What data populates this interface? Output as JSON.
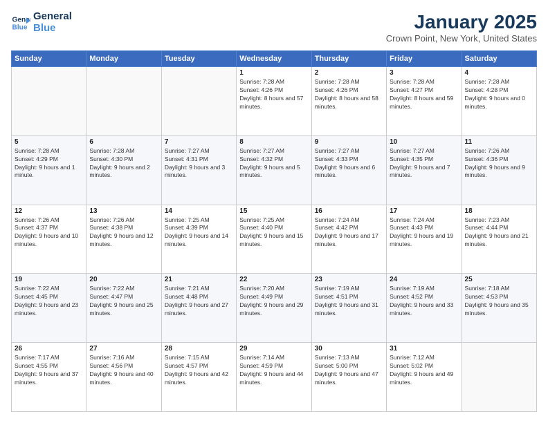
{
  "logo": {
    "line1": "General",
    "line2": "Blue"
  },
  "title": "January 2025",
  "subtitle": "Crown Point, New York, United States",
  "weekdays": [
    "Sunday",
    "Monday",
    "Tuesday",
    "Wednesday",
    "Thursday",
    "Friday",
    "Saturday"
  ],
  "weeks": [
    [
      {
        "day": "",
        "text": ""
      },
      {
        "day": "",
        "text": ""
      },
      {
        "day": "",
        "text": ""
      },
      {
        "day": "1",
        "text": "Sunrise: 7:28 AM\nSunset: 4:26 PM\nDaylight: 8 hours and 57 minutes."
      },
      {
        "day": "2",
        "text": "Sunrise: 7:28 AM\nSunset: 4:26 PM\nDaylight: 8 hours and 58 minutes."
      },
      {
        "day": "3",
        "text": "Sunrise: 7:28 AM\nSunset: 4:27 PM\nDaylight: 8 hours and 59 minutes."
      },
      {
        "day": "4",
        "text": "Sunrise: 7:28 AM\nSunset: 4:28 PM\nDaylight: 9 hours and 0 minutes."
      }
    ],
    [
      {
        "day": "5",
        "text": "Sunrise: 7:28 AM\nSunset: 4:29 PM\nDaylight: 9 hours and 1 minute."
      },
      {
        "day": "6",
        "text": "Sunrise: 7:28 AM\nSunset: 4:30 PM\nDaylight: 9 hours and 2 minutes."
      },
      {
        "day": "7",
        "text": "Sunrise: 7:27 AM\nSunset: 4:31 PM\nDaylight: 9 hours and 3 minutes."
      },
      {
        "day": "8",
        "text": "Sunrise: 7:27 AM\nSunset: 4:32 PM\nDaylight: 9 hours and 5 minutes."
      },
      {
        "day": "9",
        "text": "Sunrise: 7:27 AM\nSunset: 4:33 PM\nDaylight: 9 hours and 6 minutes."
      },
      {
        "day": "10",
        "text": "Sunrise: 7:27 AM\nSunset: 4:35 PM\nDaylight: 9 hours and 7 minutes."
      },
      {
        "day": "11",
        "text": "Sunrise: 7:26 AM\nSunset: 4:36 PM\nDaylight: 9 hours and 9 minutes."
      }
    ],
    [
      {
        "day": "12",
        "text": "Sunrise: 7:26 AM\nSunset: 4:37 PM\nDaylight: 9 hours and 10 minutes."
      },
      {
        "day": "13",
        "text": "Sunrise: 7:26 AM\nSunset: 4:38 PM\nDaylight: 9 hours and 12 minutes."
      },
      {
        "day": "14",
        "text": "Sunrise: 7:25 AM\nSunset: 4:39 PM\nDaylight: 9 hours and 14 minutes."
      },
      {
        "day": "15",
        "text": "Sunrise: 7:25 AM\nSunset: 4:40 PM\nDaylight: 9 hours and 15 minutes."
      },
      {
        "day": "16",
        "text": "Sunrise: 7:24 AM\nSunset: 4:42 PM\nDaylight: 9 hours and 17 minutes."
      },
      {
        "day": "17",
        "text": "Sunrise: 7:24 AM\nSunset: 4:43 PM\nDaylight: 9 hours and 19 minutes."
      },
      {
        "day": "18",
        "text": "Sunrise: 7:23 AM\nSunset: 4:44 PM\nDaylight: 9 hours and 21 minutes."
      }
    ],
    [
      {
        "day": "19",
        "text": "Sunrise: 7:22 AM\nSunset: 4:45 PM\nDaylight: 9 hours and 23 minutes."
      },
      {
        "day": "20",
        "text": "Sunrise: 7:22 AM\nSunset: 4:47 PM\nDaylight: 9 hours and 25 minutes."
      },
      {
        "day": "21",
        "text": "Sunrise: 7:21 AM\nSunset: 4:48 PM\nDaylight: 9 hours and 27 minutes."
      },
      {
        "day": "22",
        "text": "Sunrise: 7:20 AM\nSunset: 4:49 PM\nDaylight: 9 hours and 29 minutes."
      },
      {
        "day": "23",
        "text": "Sunrise: 7:19 AM\nSunset: 4:51 PM\nDaylight: 9 hours and 31 minutes."
      },
      {
        "day": "24",
        "text": "Sunrise: 7:19 AM\nSunset: 4:52 PM\nDaylight: 9 hours and 33 minutes."
      },
      {
        "day": "25",
        "text": "Sunrise: 7:18 AM\nSunset: 4:53 PM\nDaylight: 9 hours and 35 minutes."
      }
    ],
    [
      {
        "day": "26",
        "text": "Sunrise: 7:17 AM\nSunset: 4:55 PM\nDaylight: 9 hours and 37 minutes."
      },
      {
        "day": "27",
        "text": "Sunrise: 7:16 AM\nSunset: 4:56 PM\nDaylight: 9 hours and 40 minutes."
      },
      {
        "day": "28",
        "text": "Sunrise: 7:15 AM\nSunset: 4:57 PM\nDaylight: 9 hours and 42 minutes."
      },
      {
        "day": "29",
        "text": "Sunrise: 7:14 AM\nSunset: 4:59 PM\nDaylight: 9 hours and 44 minutes."
      },
      {
        "day": "30",
        "text": "Sunrise: 7:13 AM\nSunset: 5:00 PM\nDaylight: 9 hours and 47 minutes."
      },
      {
        "day": "31",
        "text": "Sunrise: 7:12 AM\nSunset: 5:02 PM\nDaylight: 9 hours and 49 minutes."
      },
      {
        "day": "",
        "text": ""
      }
    ]
  ]
}
